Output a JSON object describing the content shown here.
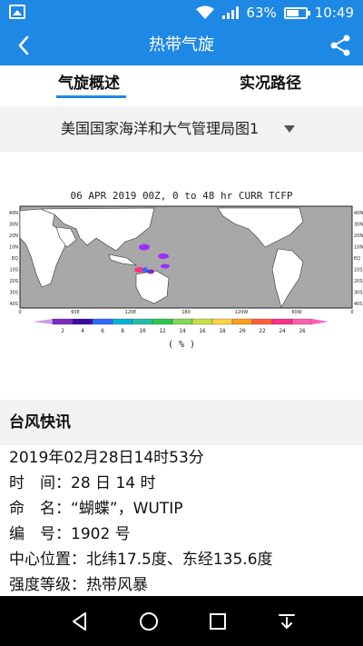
{
  "status_bar": {
    "battery": "63%",
    "time": "10:49"
  },
  "header": {
    "title": "热带气旋"
  },
  "tabs": [
    {
      "label": "气旋概述"
    },
    {
      "label": "实况路径"
    }
  ],
  "selector": {
    "value": "美国国家海洋和大气管理局图1"
  },
  "map": {
    "caption": "06 APR 2019 00Z,  0 to  48 hr CURR TCFP",
    "lat_labels": [
      "40N",
      "30N",
      "20N",
      "10N",
      "EQ",
      "10S",
      "20S",
      "30S",
      "40S"
    ],
    "lat_labels_right": [
      "40N",
      "30N",
      "20N",
      "10N",
      "EQ",
      "10S",
      "20S",
      "30S",
      "40S"
    ],
    "lon_labels": [
      "0",
      "60E",
      "120E",
      "180",
      "120W",
      "60W",
      "0"
    ],
    "colorbar_labels": [
      "2",
      "4",
      "6",
      "8",
      "10",
      "12",
      "14",
      "16",
      "18",
      "20",
      "22",
      "24",
      "26"
    ],
    "colorbar_colors": [
      "#7b2cbf",
      "#3a0ca3",
      "#2d6bff",
      "#00b4d8",
      "#22c1a8",
      "#2dc653",
      "#7ed957",
      "#c7e046",
      "#ffd23f",
      "#ff9f1c",
      "#ff5e3a",
      "#ff2e88",
      "#ff5fb0"
    ],
    "unit": "( % )"
  },
  "news": {
    "header": "台风快讯",
    "datetime": "2019年02月28日14时53分",
    "lines": [
      {
        "label": "时　间：",
        "value": "28 日 14 时"
      },
      {
        "label": "命　名：",
        "value": "“蝴蝶”，WUTIP"
      },
      {
        "label": "编　号：",
        "value": "1902 号"
      },
      {
        "label": "中心位置：",
        "value": "北纬17.5度、东经135.6度"
      },
      {
        "label": "强度等级：",
        "value": "热带风暴"
      }
    ]
  },
  "colors": {
    "accent": "#1e88e5"
  }
}
